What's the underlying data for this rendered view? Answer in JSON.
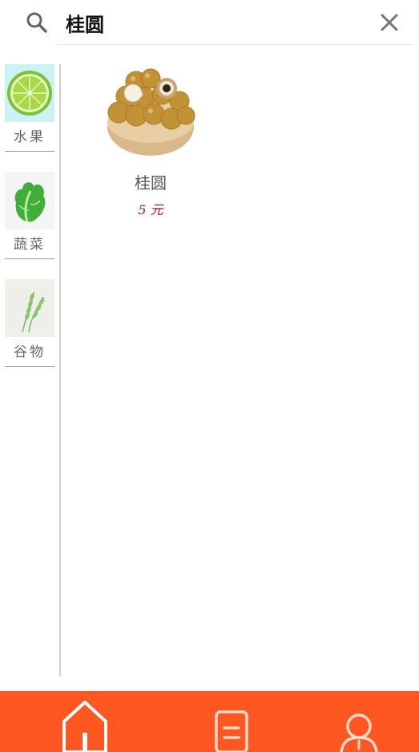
{
  "search": {
    "value": "桂圆",
    "icon": "search-icon",
    "clear_icon": "close-icon"
  },
  "categories": [
    {
      "label": "水果",
      "icon": "lime-image"
    },
    {
      "label": "蔬菜",
      "icon": "lettuce-image"
    },
    {
      "label": "谷物",
      "icon": "wheat-image"
    }
  ],
  "products": [
    {
      "name": "桂圆",
      "price": "5 元",
      "icon": "longan-image"
    }
  ],
  "tabbar": {
    "color": "#ff5722",
    "tabs": [
      {
        "icon": "home-icon"
      },
      {
        "icon": "document-icon"
      },
      {
        "icon": "user-icon"
      }
    ]
  }
}
